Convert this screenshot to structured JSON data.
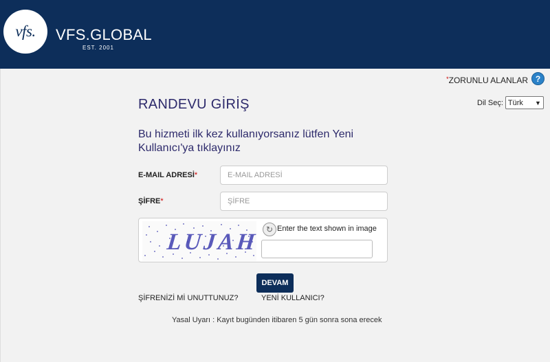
{
  "header": {
    "logo_text": "vfs.",
    "brand": "VFS.GLOBAL",
    "est": "EST. 2001",
    "background": "#0d2e5a"
  },
  "required_note": "ZORUNLU ALANLAR",
  "required_star": "*",
  "help_icon": "?",
  "page_title": "RANDEVU GİRİŞ",
  "language": {
    "label": "Dil Seç:",
    "selected": "Türk"
  },
  "info_text": "Bu hizmeti ilk kez kullanıyorsanız lütfen Yeni Kullanıcı'ya tıklayınız",
  "form": {
    "email_label": "E-MAIL ADRESİ",
    "email_placeholder": "E-MAIL ADRESİ",
    "password_label": "ŞİFRE",
    "password_placeholder": "ŞİFRE",
    "star": "*"
  },
  "captcha": {
    "image_text": "LUJAH",
    "hint": "Enter the text shown in image"
  },
  "submit_label": "DEVAM",
  "forgot_label": "ŞİFRENİZİ Mİ UNUTTUNUZ?",
  "new_user_label": "YENİ KULLANICI?",
  "legal_notice": "Yasal Uyarı : Kayıt bugünden itibaren 5 gün sonra sona erecek"
}
